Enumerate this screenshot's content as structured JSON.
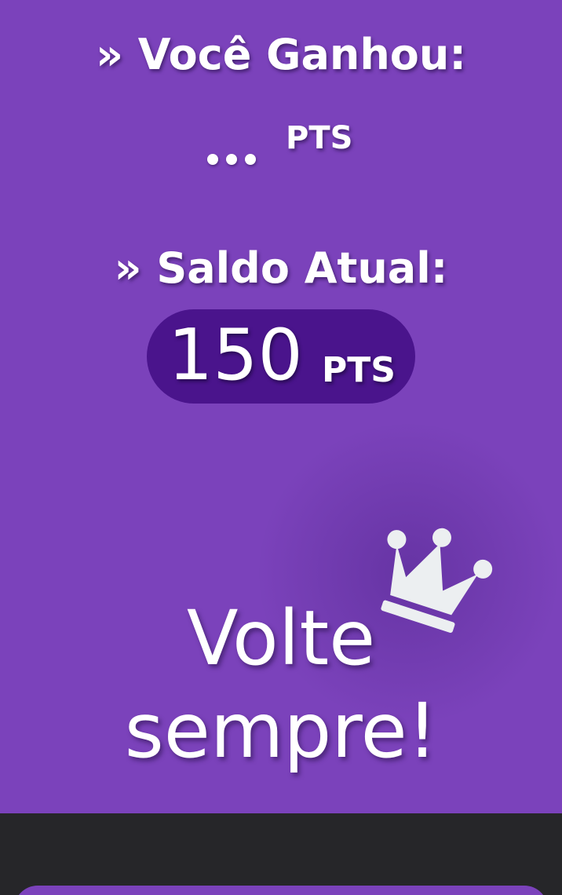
{
  "earned": {
    "heading": "» Você Ganhou:",
    "value": "...",
    "unit": "PTS"
  },
  "balance": {
    "heading": "» Saldo Atual:",
    "value": "150",
    "unit": "PTS"
  },
  "farewell": {
    "line1": "Volte",
    "line2": "sempre!"
  },
  "icons": {
    "crown": "crown-icon"
  },
  "colors": {
    "background": "#7b42bb",
    "pill": "#4a148c",
    "footer": "#262629",
    "crown": "#eceff1",
    "text": "#ffffff"
  }
}
